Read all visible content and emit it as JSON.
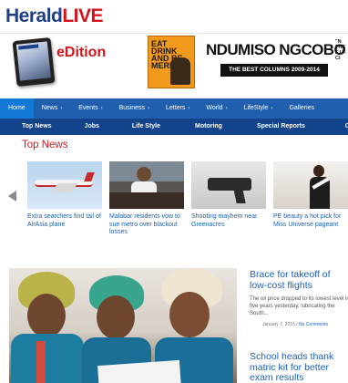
{
  "logo": {
    "part1": "Herald",
    "part2": "LIVE"
  },
  "banner": {
    "edition_label": "eDition",
    "book_cover_text": "EAT DRINK AND BE MERRY",
    "promo_name": "NDUMISO NGCOBO",
    "promo_tagline": "THE BEST COLUMNS 2009-2014",
    "side_text": "\"N THE F U -CI"
  },
  "nav_main": [
    {
      "label": "Home",
      "chevron": false
    },
    {
      "label": "News",
      "chevron": true
    },
    {
      "label": "Events",
      "chevron": true
    },
    {
      "label": "Business",
      "chevron": true
    },
    {
      "label": "Letters",
      "chevron": true
    },
    {
      "label": "World",
      "chevron": true
    },
    {
      "label": "LifeStyle",
      "chevron": true
    },
    {
      "label": "Galleries",
      "chevron": false
    }
  ],
  "nav_sub": [
    "Top News",
    "Jobs",
    "Life Style",
    "Motoring",
    "Special Reports",
    "Classifieds"
  ],
  "top_news": {
    "title": "Top News",
    "items": [
      {
        "caption": "Extra searchers find tail of AirAsia plane"
      },
      {
        "caption": "Malabar residents vow to sue metro over blackout losses"
      },
      {
        "caption": "Shooting mayhem near Greenacres"
      },
      {
        "caption": "PE beauty a hot pick for Miss Universe pageant"
      }
    ]
  },
  "stories": [
    {
      "headline": "Brace for takeoff of low-cost flights",
      "summary": "The oil price dropped to its lowest level in five years yesterday, lubricating the South...",
      "date": "January 7, 2015 / ",
      "comments": "No Comments"
    },
    {
      "headline": "School heads thank matric kit for better exam results",
      "summary": "",
      "date": "",
      "comments": ""
    }
  ],
  "colors": {
    "brand_blue": "#1c3f8a",
    "brand_red": "#d8131b",
    "nav_blue": "#1f5fae",
    "subnav_blue": "#13438b",
    "link_blue": "#1c60b6"
  }
}
